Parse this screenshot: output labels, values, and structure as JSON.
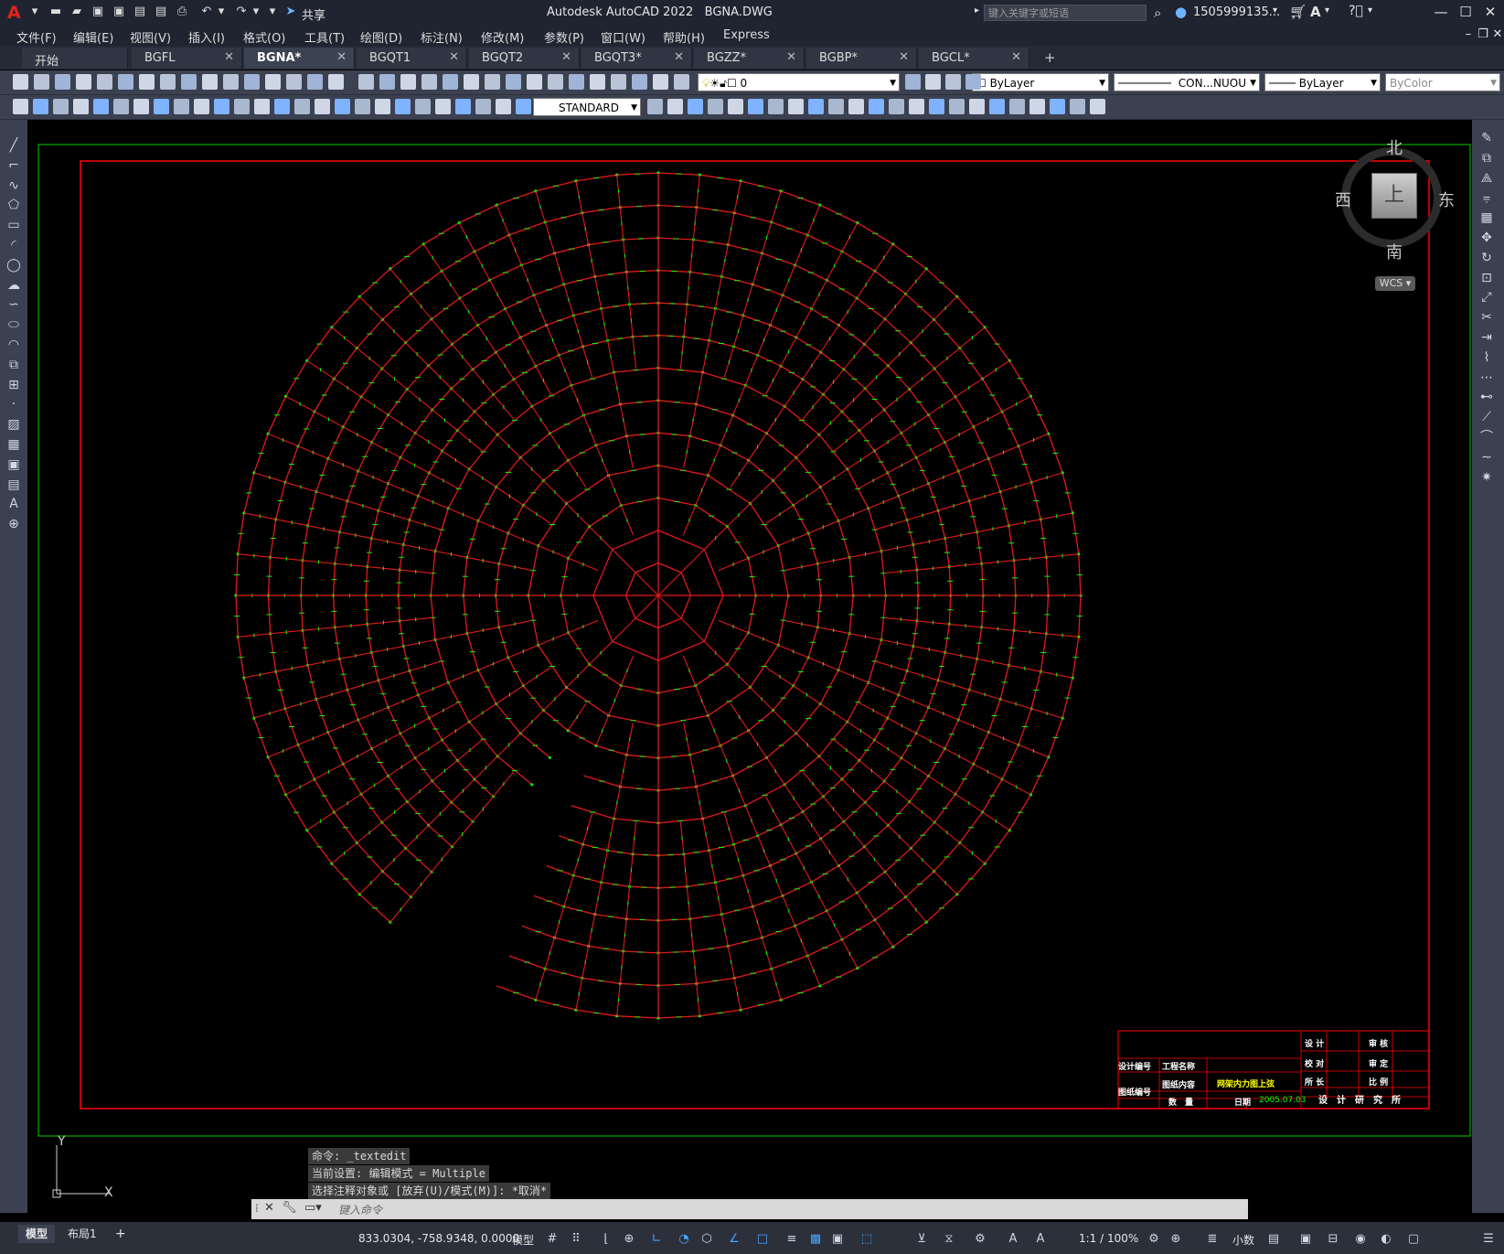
{
  "titlebar": {
    "app_title": "Autodesk AutoCAD 2022",
    "file_name": "BGNA.DWG",
    "share_label": "共享",
    "search_placeholder": "键入关键字或短语",
    "user": "1505999135...",
    "logo": "A"
  },
  "menu": [
    "文件(F)",
    "编辑(E)",
    "视图(V)",
    "插入(I)",
    "格式(O)",
    "工具(T)",
    "绘图(D)",
    "标注(N)",
    "修改(M)",
    "参数(P)",
    "窗口(W)",
    "帮助(H)",
    "Express"
  ],
  "tabs": [
    {
      "label": "开始",
      "active": false,
      "closable": false
    },
    {
      "label": "BGFL",
      "active": false,
      "closable": true
    },
    {
      "label": "BGNA*",
      "active": true,
      "closable": true
    },
    {
      "label": "BGQT1",
      "active": false,
      "closable": true
    },
    {
      "label": "BGQT2",
      "active": false,
      "closable": true
    },
    {
      "label": "BGQT3*",
      "active": false,
      "closable": true
    },
    {
      "label": "BGZZ*",
      "active": false,
      "closable": true
    },
    {
      "label": "BGBP*",
      "active": false,
      "closable": true
    },
    {
      "label": "BGCL*",
      "active": false,
      "closable": true
    }
  ],
  "add_tab_label": "+",
  "properties": {
    "layer": "0",
    "color": "ByLayer",
    "linetype": "CON...NUOU",
    "lineweight": "ByLayer",
    "plotstyle": "ByColor",
    "text_style": "STANDARD"
  },
  "viewcube": {
    "north": "北",
    "south": "南",
    "east": "东",
    "west": "西",
    "face": "上",
    "wcs": "WCS"
  },
  "ucs": {
    "x": "X",
    "y": "Y"
  },
  "command": {
    "lines": [
      "命令: _textedit",
      "当前设置: 编辑模式 = Multiple",
      "选择注释对象或 [放弃(U)/模式(M)]: *取消*"
    ],
    "prompt_placeholder": "键入命令"
  },
  "title_block": {
    "design_no": "设计编号",
    "project_name": "工程名称",
    "drawing_no": "图纸编号",
    "drawing_content": "图纸内容",
    "drawing_title": "网架内力图上弦",
    "quantity": "数　量",
    "date_label": "日期",
    "date_value": "2005.07.03",
    "design": "设 计",
    "check": "校 对",
    "director": "所 长",
    "review": "审 核",
    "approve": "审 定",
    "scale": "比 例",
    "institute": "设　计　研　究　所"
  },
  "status": {
    "model_tab": "模型",
    "layout_tab": "布局1",
    "add": "+",
    "coordinates": "833.0304, -758.9348, 0.0000",
    "space": "模型",
    "scale": "1:1 / 100%",
    "units": "小数"
  },
  "colors": {
    "grid_red": "#e3181c",
    "member_green": "#00ff00",
    "frame_green": "#00b000",
    "border_red": "#ff0000",
    "chrome_dark": "#1f2430",
    "toolbar": "#3b4150"
  }
}
